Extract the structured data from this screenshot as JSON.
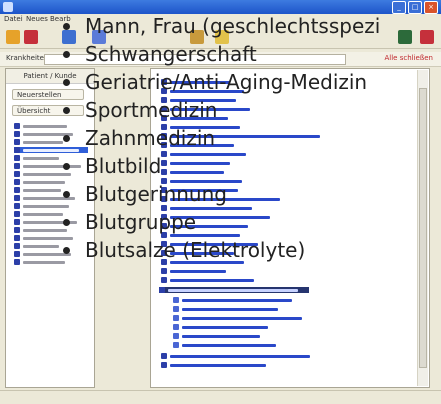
{
  "window": {
    "title": "",
    "buttons": [
      "_",
      "□",
      "×"
    ]
  },
  "menu": [
    "Datei",
    "Neues",
    "Bearb"
  ],
  "address": {
    "label": "Krankheiten",
    "close_label": "Alle schließen"
  },
  "left_panel": {
    "header": "Patient / Kunde",
    "buttons": [
      "Neuerstellen",
      "Übersicht"
    ]
  },
  "overlay_list": [
    "Mann, Frau (geschlechtsspezi",
    "Schwangerschaft",
    "Geriatrie/Anti-Aging-Medizin",
    "Sportmedizin",
    "Zahnmedizin",
    "Blutbild",
    "Blutgerinnung",
    "Blutgruppe",
    "Blutsalze (Elektrolyte)"
  ],
  "colors": {
    "titlebar": "#1d54c9",
    "selection": "#2f5ed8",
    "link": "#2a48c9",
    "background": "#ece9d8"
  }
}
